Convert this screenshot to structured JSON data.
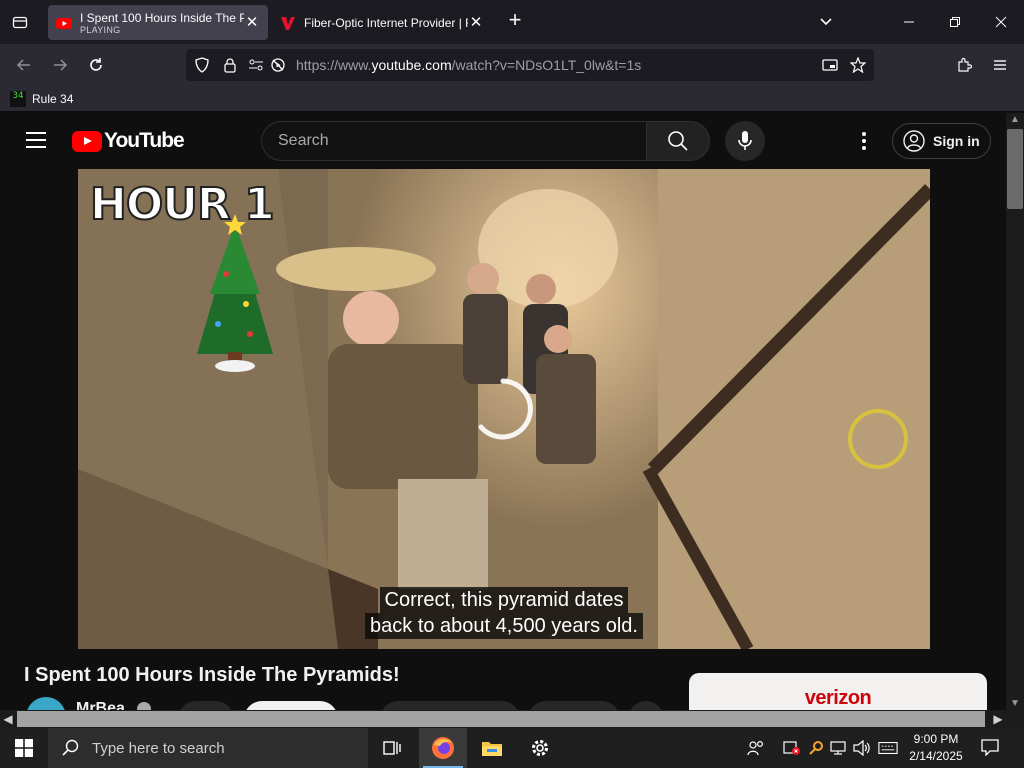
{
  "browser": {
    "tabs": [
      {
        "title": "I Spent 100 Hours Inside The Pyramids!",
        "status": "PLAYING",
        "active": true
      },
      {
        "title": "Fiber-Optic Internet Provider | Fios",
        "active": false
      }
    ],
    "url": {
      "scheme": "https://www.",
      "host": "youtube.com",
      "path": "/watch?v=NDsO1LT_0lw&t=1s"
    },
    "bookmarks": [
      {
        "label": "Rule 34",
        "favicon_text": "34"
      }
    ]
  },
  "youtube": {
    "logo_text": "YouTube",
    "search_placeholder": "Search",
    "signin_label": "Sign in"
  },
  "video": {
    "overlay_title": "HOUR 1",
    "caption_lines": [
      "Correct, this pyramid dates",
      "back to about 4,500 years old."
    ],
    "title": "I Spent 100 Hours Inside The Pyramids!",
    "channel": "MrBea"
  },
  "ad": {
    "brand": "verizon"
  },
  "taskbar": {
    "search_placeholder": "Type here to search",
    "time": "9:00 PM",
    "date": "2/14/2025"
  },
  "colors": {
    "youtube_red": "#ff0000",
    "browser_bg": "#1c1b22",
    "toolbar_bg": "#2b2a33",
    "page_bg": "#0f0f0f",
    "verizon_red": "#cd040b"
  }
}
